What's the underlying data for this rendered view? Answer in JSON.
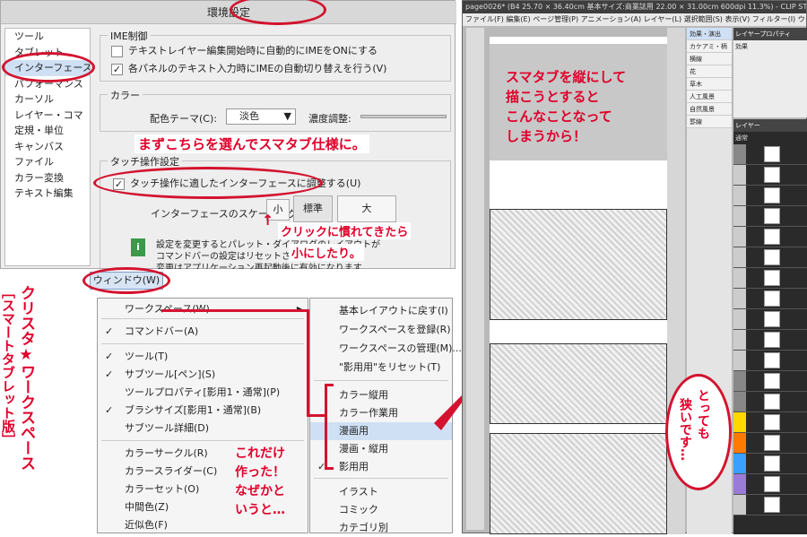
{
  "prefs": {
    "title": "環境設定",
    "categories": [
      "ツール",
      "タブレット",
      "インターフェース",
      "パフォーマンス",
      "カーソル",
      "レイヤー・コマ",
      "定規・単位",
      "キャンバス",
      "ファイル",
      "カラー変換",
      "テキスト編集"
    ],
    "ime_group": "IME制御",
    "ime_opt1": "テキストレイヤー編集開始時に自動的にIMEをONにする",
    "ime_opt2": "各パネルのテキスト入力時にIMEの自動切り替えを行う(V)",
    "color_group": "カラー",
    "theme_label": "配色テーマ(C):",
    "theme_value": "淡色",
    "density_label": "濃度調整:",
    "touch_group": "タッチ操作設定",
    "touch_opt": "タッチ操作に適したインターフェースに調整する(U)",
    "scaling_label": "インターフェースのスケーリング:",
    "scale_small": "小",
    "scale_std": "標準",
    "scale_large": "大",
    "info_line1": "設定を変更するとパレット・ダイアログのレイアウトが",
    "info_line2": "コマンドバーの設定はリセットされます",
    "info_line3": "変更はアプリケーション再起動後に有効になります"
  },
  "menu": {
    "window_button": "ウィンドウ(W)",
    "items": [
      {
        "label": "ワークスペース(W)",
        "check": false,
        "arrow": true
      },
      {
        "label": "コマンドバー(A)",
        "check": true
      },
      {
        "label": "ツール(T)",
        "check": true
      },
      {
        "label": "サブツール[ペン](S)",
        "check": true
      },
      {
        "label": "ツールプロパティ[影用1・通常](P)",
        "check": false
      },
      {
        "label": "ブラシサイズ[影用1・通常](B)",
        "check": true
      },
      {
        "label": "サブツール詳細(D)",
        "check": false
      },
      {
        "label": "カラーサークル(R)",
        "check": false
      },
      {
        "label": "カラースライダー(C)",
        "check": false
      },
      {
        "label": "カラーセット(O)",
        "check": false
      },
      {
        "label": "中間色(Z)",
        "check": false
      },
      {
        "label": "近似色(F)",
        "check": false
      }
    ],
    "sub_items": [
      {
        "label": "基本レイアウトに戻す(I)"
      },
      {
        "label": "ワークスペースを登録(R)"
      },
      {
        "label": "ワークスペースの管理(M)..."
      },
      {
        "label": "\"影用用\"をリセット(T)"
      },
      {
        "label": "カラー縦用"
      },
      {
        "label": "カラー作業用"
      },
      {
        "label": "漫画用",
        "highlight": true
      },
      {
        "label": "漫画・縦用"
      },
      {
        "label": "影用用",
        "check": true
      },
      {
        "label": "イラスト"
      },
      {
        "label": "コミック"
      },
      {
        "label": "カテゴリ別"
      }
    ]
  },
  "annotations": {
    "choose_here": "まずこちらを選んでスマタブ仕様に。",
    "click_line1": "クリックに慣れてきたら",
    "click_line2": "小にしたり。",
    "made_line1": "これだけ",
    "made_line2": "作った！",
    "made_line3": "なぜかと",
    "made_line4": "いうと…",
    "vertical_title": "クリスタ★ワークスペース",
    "vertical_sub": "［スマートタブレット版］",
    "right_line1": "スマタブを縦にして",
    "right_line2": "描こうとすると",
    "right_line3": "こんなことなって",
    "right_line4": "しまうから！",
    "narrow_line1": "とっても",
    "narrow_line2": "狭いです…",
    "accent": "#d3132f"
  },
  "app": {
    "title": "page0026* (B4 25.70 × 36.40cm 基本サイズ:商業誌用 22.00 × 31.00cm 600dpi 11.3%) - CLIP STUDIO",
    "menubar": "ファイル(F)  編集(E)  ページ管理(P)  アニメーション(A)  レイヤー(L)  選択範囲(S)  表示(V)  フィルター(I)  ウィンドウ(W)  ヘルプ(H)",
    "subtools": [
      "効果・演出",
      "カケアミ・柄",
      "横線",
      "花",
      "草木",
      "人工風景",
      "自然風景",
      "罫線"
    ],
    "layer_tab": "レイヤープロパティ",
    "effect_label": "効果",
    "layers_tab": "レイヤー",
    "layer_mode": "通常"
  }
}
